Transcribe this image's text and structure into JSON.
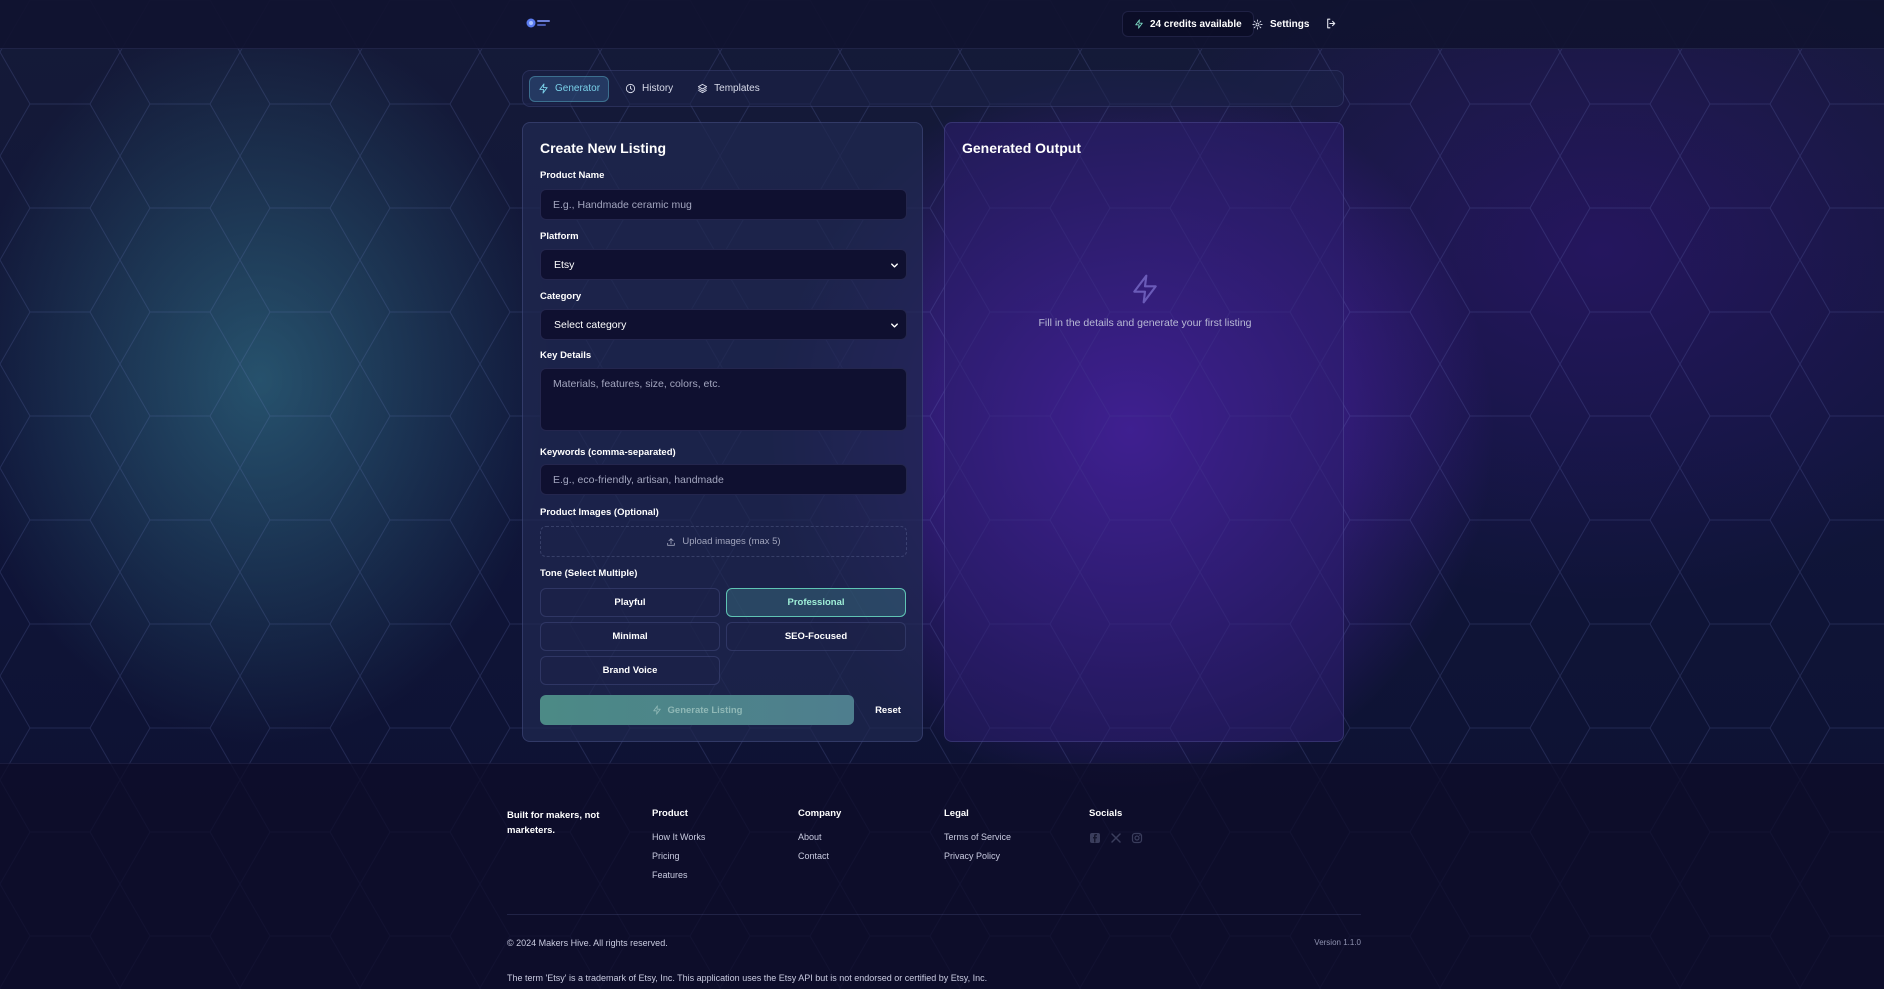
{
  "colors": {
    "accent_teal": "#5fc4b4",
    "tab_active": "#79d0e8",
    "panel_left": "#202850",
    "panel_right": "#2c1e6e",
    "page_bg": "#10163a"
  },
  "nav": {
    "credits_label": "24 credits available",
    "settings_label": "Settings",
    "logo_icon": "logo-mark",
    "logout_icon": "logout-icon"
  },
  "tabs": [
    {
      "label": "Generator",
      "icon": "bolt-icon",
      "active": true
    },
    {
      "label": "History",
      "icon": "clock-icon",
      "active": false
    },
    {
      "label": "Templates",
      "icon": "layers-icon",
      "active": false
    }
  ],
  "form": {
    "title": "Create New Listing",
    "product_name": {
      "label": "Product Name",
      "placeholder": "E.g., Handmade ceramic mug",
      "value": ""
    },
    "platform": {
      "label": "Platform",
      "value": "Etsy"
    },
    "category": {
      "label": "Category",
      "value": "Select category"
    },
    "key_details": {
      "label": "Key Details",
      "placeholder": "Materials, features, size, colors, etc.",
      "value": ""
    },
    "keywords": {
      "label": "Keywords (comma-separated)",
      "placeholder": "E.g., eco-friendly, artisan, handmade",
      "value": ""
    },
    "images": {
      "label": "Product Images (Optional)",
      "upload_label": "Upload images (max 5)"
    },
    "tone": {
      "label": "Tone (Select Multiple)",
      "options": [
        {
          "label": "Playful",
          "selected": false
        },
        {
          "label": "Professional",
          "selected": true
        },
        {
          "label": "Minimal",
          "selected": false
        },
        {
          "label": "SEO-Focused",
          "selected": false
        },
        {
          "label": "Brand Voice",
          "selected": false
        }
      ]
    },
    "generate_label": "Generate Listing",
    "reset_label": "Reset"
  },
  "output": {
    "title": "Generated Output",
    "empty_message": "Fill in the details and generate your first listing"
  },
  "footer": {
    "tagline": "Built for makers, not marketers.",
    "columns": [
      {
        "heading": "Product",
        "links": [
          "How It Works",
          "Pricing",
          "Features"
        ]
      },
      {
        "heading": "Company",
        "links": [
          "About",
          "Contact"
        ]
      },
      {
        "heading": "Legal",
        "links": [
          "Terms of Service",
          "Privacy Policy"
        ]
      }
    ],
    "socials_heading": "Socials",
    "social_icons": [
      "facebook-icon",
      "x-icon",
      "instagram-icon"
    ],
    "copyright": "© 2024 Makers Hive. All rights reserved.",
    "version": "Version 1.1.0",
    "trademark": "The term 'Etsy' is a trademark of Etsy, Inc. This application uses the Etsy API but is not endorsed or certified by Etsy, Inc."
  }
}
